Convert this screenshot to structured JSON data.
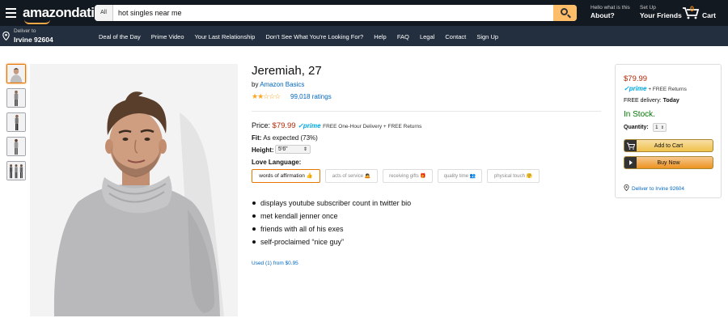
{
  "header": {
    "logo": "amazondating",
    "search": {
      "category": "All",
      "query": "hot singles near me"
    },
    "account": [
      {
        "small": "Hello what is this",
        "large": "About?"
      },
      {
        "small": "Set Up",
        "large": "Your Friends"
      }
    ],
    "cart": {
      "count": "0",
      "label": "Cart"
    }
  },
  "nav": {
    "deliver_small": "Deliver to",
    "deliver_large": "Irvine 92604",
    "links": [
      "Deal of the Day",
      "Prime Video",
      "Your Last Relationship",
      "Don't See What You're Looking For?",
      "Help",
      "FAQ",
      "Legal",
      "Contact",
      "Sign Up"
    ]
  },
  "product": {
    "title": "Jeremiah, 27",
    "by_prefix": "by",
    "brand": "Amazon Basics",
    "stars": "★★☆☆☆",
    "rating_value": 2,
    "ratings_count": "99,018 ratings",
    "price_label": "Price:",
    "price": "$79.99",
    "prime": "✓prime",
    "price_note": "FREE One-Hour Delivery + FREE Returns",
    "fit_label": "Fit:",
    "fit_value": "As expected (73%)",
    "height_label": "Height:",
    "height_value": "5'6\"",
    "love_label": "Love Language:",
    "love_options": [
      "words of affirmation 👍",
      "acts of service 🙇",
      "receiving gifts 🎁",
      "quality time 👥",
      "physical touch 🤗"
    ],
    "bullets": [
      "displays youtube subscriber count in twitter bio",
      "met kendall jenner once",
      "friends with all of his exes",
      "self-proclaimed “nice guy”"
    ],
    "used": "Used (1) from $0.95"
  },
  "buybox": {
    "price": "$79.99",
    "prime": "✓prime",
    "prime_note": "+ FREE Returns",
    "delivery_label": "FREE delivery:",
    "delivery_value": "Today",
    "stock": "In Stock.",
    "qty_label": "Quantity:",
    "qty_value": "1",
    "add_to_cart": "Add to Cart",
    "buy_now": "Buy Now",
    "deliver_to": "Deliver to Irvine 92604"
  },
  "colors": {
    "topbar": "#131921",
    "navbar": "#232f3e",
    "price_red": "#b12704",
    "link_blue": "#0066c0",
    "stock_green": "#007600",
    "accent_orange": "#e77600"
  }
}
